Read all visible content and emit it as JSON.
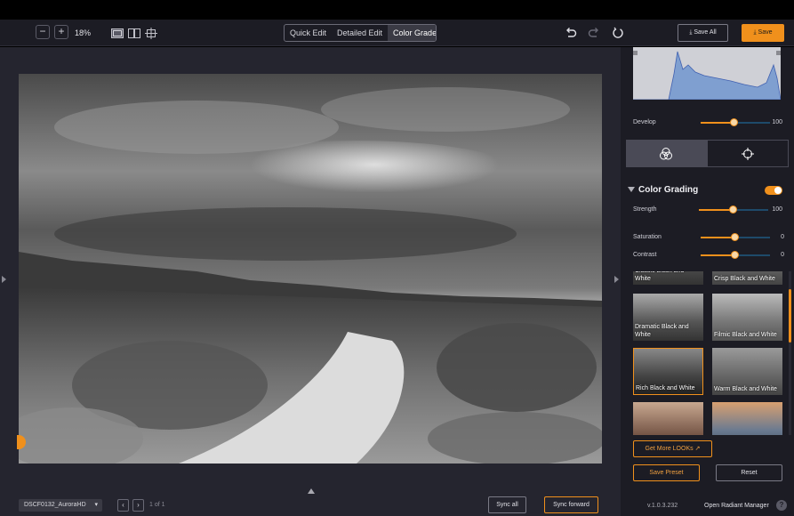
{
  "toolbar": {
    "zoom_out": "−",
    "zoom_in": "+",
    "zoom_level": "18%",
    "modes": [
      "Quick Edit",
      "Detailed Edit",
      "Color Grade"
    ],
    "active_mode": "Color Grade",
    "save_all": "Save All",
    "save": "Save",
    "accent": "#f0901c"
  },
  "canvas": {
    "filename": "DSCF0132_AuroraHD",
    "page": "1 of 1",
    "sync_all": "Sync all",
    "sync_forward": "Sync forward"
  },
  "panel": {
    "develop": {
      "label": "Develop",
      "value": "100",
      "fraction": 0.62
    },
    "color_grading": {
      "title": "Color Grading",
      "enabled": true,
      "strength": {
        "label": "Strength",
        "value": "100",
        "fraction": 0.5
      },
      "saturation": {
        "label": "Saturation",
        "value": "0",
        "fraction": 0.5
      },
      "contrast": {
        "label": "Contrast",
        "value": "0",
        "fraction": 0.5
      }
    },
    "looks": [
      {
        "label": "Classic Black and White"
      },
      {
        "label": "Crisp Black and White"
      },
      {
        "label": "Dramatic Black and White"
      },
      {
        "label": "Filmic Black and White"
      },
      {
        "label": "Rich Black and White",
        "selected": true
      },
      {
        "label": "Warm Black and White"
      },
      {
        "label": ""
      },
      {
        "label": ""
      }
    ],
    "get_more": "Get More LOOKs",
    "save_preset": "Save Preset",
    "reset": "Reset",
    "version": "v.1.0.3.232",
    "radiant_manager": "Open Radiant Manager",
    "help": "?"
  }
}
